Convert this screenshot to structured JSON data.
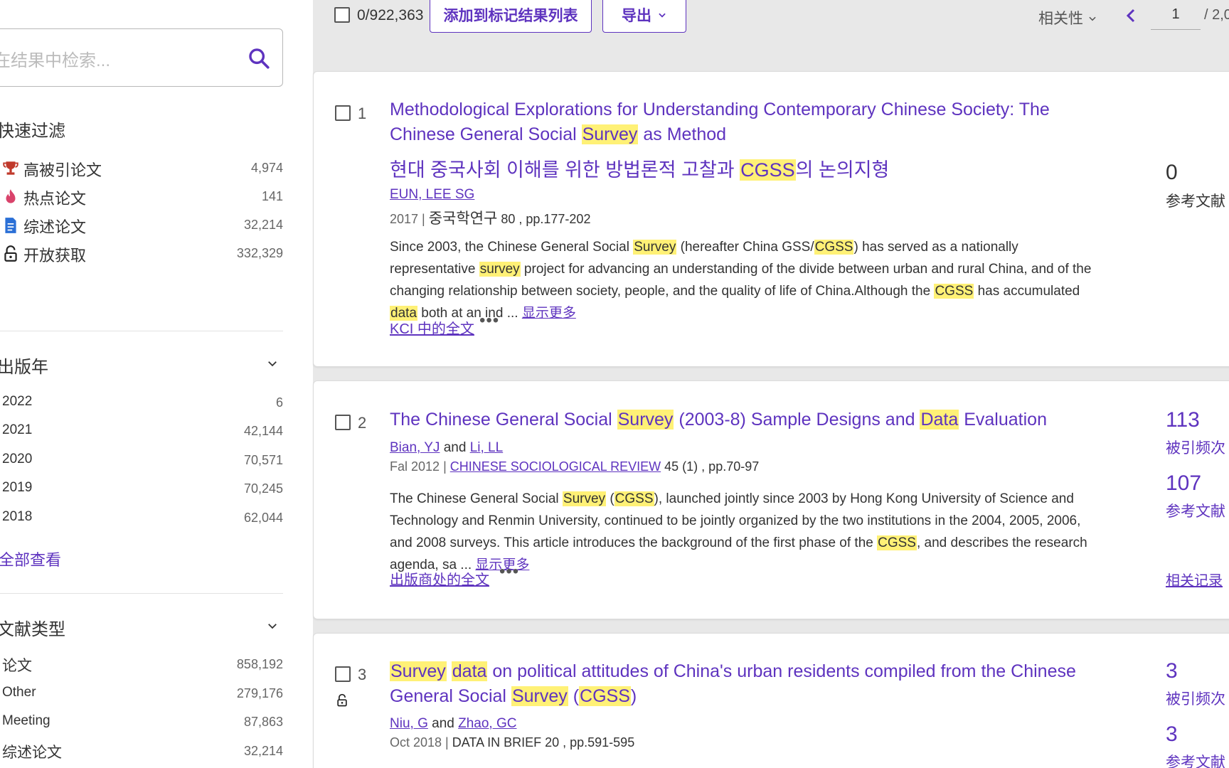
{
  "sidebar": {
    "search_placeholder": "在结果中检索...",
    "quick_filter": {
      "heading": "快速过滤",
      "items": [
        {
          "label": "高被引论文",
          "count": "4,974",
          "icon": "trophy-icon"
        },
        {
          "label": "热点论文",
          "count": "141",
          "icon": "flame-icon"
        },
        {
          "label": "综述论文",
          "count": "32,214",
          "icon": "document-icon"
        },
        {
          "label": "开放获取",
          "count": "332,329",
          "icon": "lock-icon"
        }
      ]
    },
    "pub_year": {
      "heading": "出版年",
      "items": [
        {
          "label": "2022",
          "count": "6"
        },
        {
          "label": "2021",
          "count": "42,144"
        },
        {
          "label": "2020",
          "count": "70,571"
        },
        {
          "label": "2019",
          "count": "70,245"
        },
        {
          "label": "2018",
          "count": "62,044"
        }
      ],
      "view_all": "全部查看"
    },
    "doc_type": {
      "heading": "文献类型",
      "items": [
        {
          "label": "论文",
          "count": "858,192"
        },
        {
          "label": "Other",
          "count": "279,176"
        },
        {
          "label": "Meeting",
          "count": "87,863"
        },
        {
          "label": "综述论文",
          "count": "32,214"
        }
      ]
    }
  },
  "toolbar": {
    "selected_count": "0/922,363",
    "add_to_marked_label": "添加到标记结果列表",
    "export_label": "导出",
    "sort_label": "相关性",
    "page_current": "1",
    "page_total": "/ 2,0"
  },
  "results": [
    {
      "index": "1",
      "title_parts": [
        {
          "t": "Methodological Explorations for Understanding Contemporary Chinese Society: The Chinese General Social ",
          "h": false
        },
        {
          "t": "Survey",
          "h": true
        },
        {
          "t": " as Method",
          "h": false
        }
      ],
      "title_ko_parts": [
        {
          "t": "현대 중국사회 이해를 위한 방법론적 고찰과 ",
          "h": false
        },
        {
          "t": "CGSS",
          "h": true
        },
        {
          "t": "의 논의지형",
          "h": false
        }
      ],
      "authors": [
        "EUN, LEE SG"
      ],
      "year": "2017",
      "source": "중국학연구",
      "source_detail": " 80 , pp.177-202",
      "abstract_parts": [
        {
          "t": "Since 2003, the Chinese General Social ",
          "h": false
        },
        {
          "t": "Survey",
          "h": true
        },
        {
          "t": " (hereafter China GSS/",
          "h": false
        },
        {
          "t": "CGSS",
          "h": true
        },
        {
          "t": ") has served as a nationally representative ",
          "h": false
        },
        {
          "t": "survey",
          "h": true
        },
        {
          "t": " project for advancing an understanding of the divide between urban and rural China, and of the changing relationship between society, people, and the quality of life of China.Although the ",
          "h": false
        },
        {
          "t": "CGSS",
          "h": true
        },
        {
          "t": " has accumulated ",
          "h": false
        },
        {
          "t": "data",
          "h": true
        },
        {
          "t": " both at an ind ... ",
          "h": false
        }
      ],
      "show_more": "显示更多",
      "fulltext": "KCI 中的全文",
      "metrics": [
        {
          "value": "0",
          "label": "参考文献"
        }
      ]
    },
    {
      "index": "2",
      "title_parts": [
        {
          "t": "The Chinese General Social ",
          "h": false
        },
        {
          "t": "Survey",
          "h": true
        },
        {
          "t": " (2003-8) Sample Designs and ",
          "h": false
        },
        {
          "t": "Data",
          "h": true
        },
        {
          "t": " Evaluation",
          "h": false
        }
      ],
      "authors": [
        "Bian, YJ",
        "Li, LL"
      ],
      "author_join": "and",
      "year": "Fal 2012",
      "source": "CHINESE SOCIOLOGICAL REVIEW",
      "source_detail": " 45 (1) , pp.70-97",
      "abstract_parts": [
        {
          "t": "The Chinese General Social ",
          "h": false
        },
        {
          "t": "Survey",
          "h": true
        },
        {
          "t": " (",
          "h": false
        },
        {
          "t": "CGSS",
          "h": true
        },
        {
          "t": "), launched jointly since 2003 by Hong Kong University of Science and Technology and Renmin University, continued to be jointly organized by the two institutions in the 2004, 2005, 2006, and 2008 surveys. This article introduces the background of the first phase of the ",
          "h": false
        },
        {
          "t": "CGSS",
          "h": true
        },
        {
          "t": ", and describes the research agenda, sa ... ",
          "h": false
        }
      ],
      "show_more": "显示更多",
      "fulltext": "出版商处的全文",
      "metrics": [
        {
          "value": "113",
          "label": "被引频次"
        },
        {
          "value": "107",
          "label": "参考文献"
        }
      ],
      "related": "相关记录"
    },
    {
      "index": "3",
      "title_parts": [
        {
          "t": "Survey",
          "h": true
        },
        {
          "t": " ",
          "h": false
        },
        {
          "t": "data",
          "h": true
        },
        {
          "t": " on political attitudes of China's urban residents compiled from the Chinese General Social ",
          "h": false
        },
        {
          "t": "Survey",
          "h": true
        },
        {
          "t": " (",
          "h": false
        },
        {
          "t": "CGSS",
          "h": true
        },
        {
          "t": ")",
          "h": false
        }
      ],
      "authors": [
        "Niu, G",
        "Zhao, GC"
      ],
      "author_join": "and",
      "year": "Oct 2018",
      "source": "DATA IN BRIEF",
      "source_detail": " 20 , pp.591-595",
      "metrics": [
        {
          "value": "3",
          "label": "被引频次"
        },
        {
          "value": "3",
          "label": "参考文献"
        }
      ]
    }
  ],
  "colors": {
    "accent": "#5e33bf",
    "highlight": "#fff176",
    "toolbar_bg": "#e8e8e8"
  }
}
